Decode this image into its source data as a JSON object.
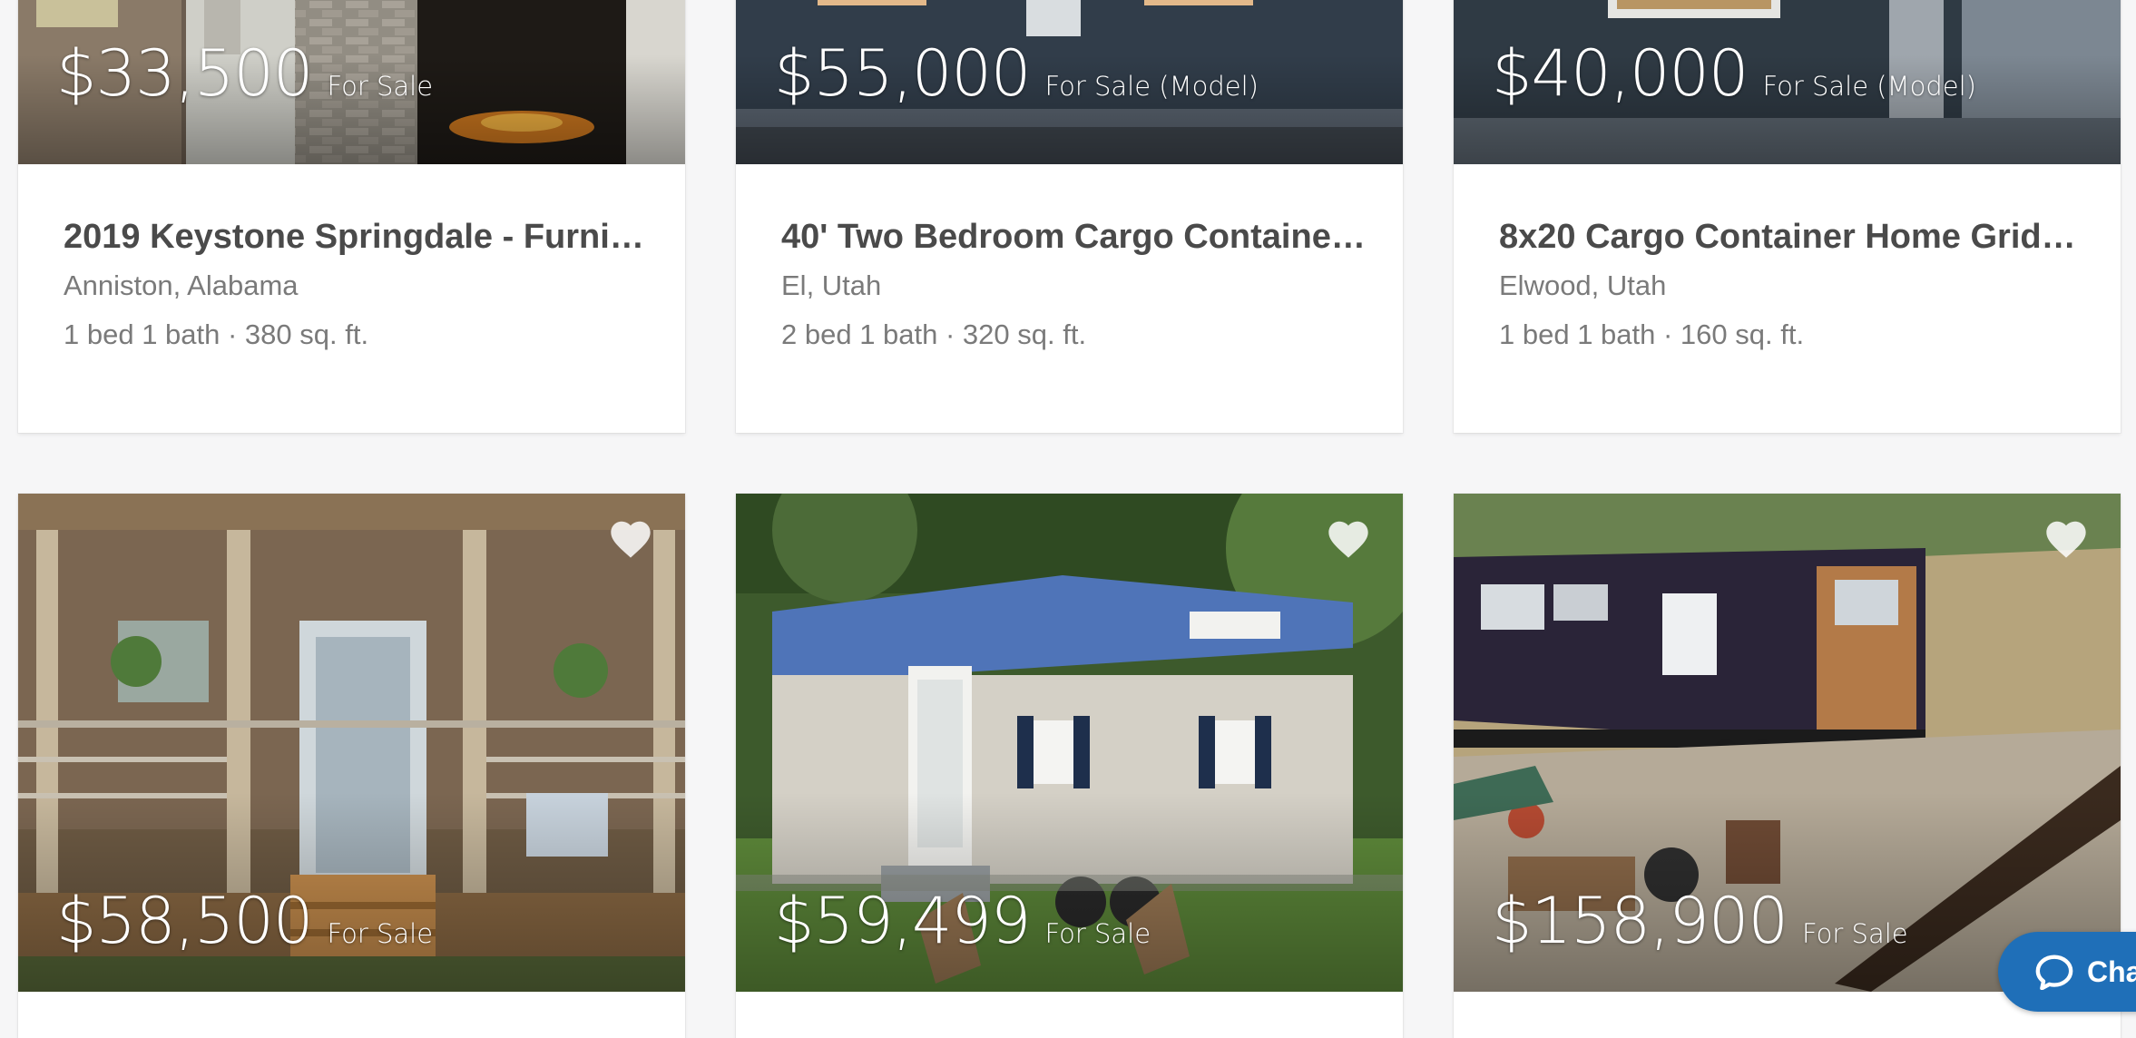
{
  "listings_row1": [
    {
      "price": "$33,500",
      "status": "For Sale",
      "title": "2019 Keystone Springdale - Furni…",
      "location": "Anniston, Alabama",
      "specs": "1 bed 1 bath · 380 sq. ft."
    },
    {
      "price": "$55,000",
      "status": "For Sale (Model)",
      "title": "40' Two Bedroom Cargo Containe…",
      "location": "El, Utah",
      "specs": "2 bed 1 bath · 320 sq. ft."
    },
    {
      "price": "$40,000",
      "status": "For Sale (Model)",
      "title": "8x20 Cargo Container Home Grid …",
      "location": "Elwood, Utah",
      "specs": "1 bed 1 bath · 160 sq. ft."
    }
  ],
  "listings_row2": [
    {
      "price": "$58,500",
      "status": "For Sale"
    },
    {
      "price": "$59,499",
      "status": "For Sale"
    },
    {
      "price": "$158,900",
      "status": "For Sale"
    }
  ],
  "chat": {
    "label": "Cha"
  },
  "icons": {
    "favorite": "heart-icon",
    "chat": "chat-bubble-icon"
  },
  "colors": {
    "chat_button": "#1f6fb8",
    "page_bg": "#f6f6f7"
  }
}
